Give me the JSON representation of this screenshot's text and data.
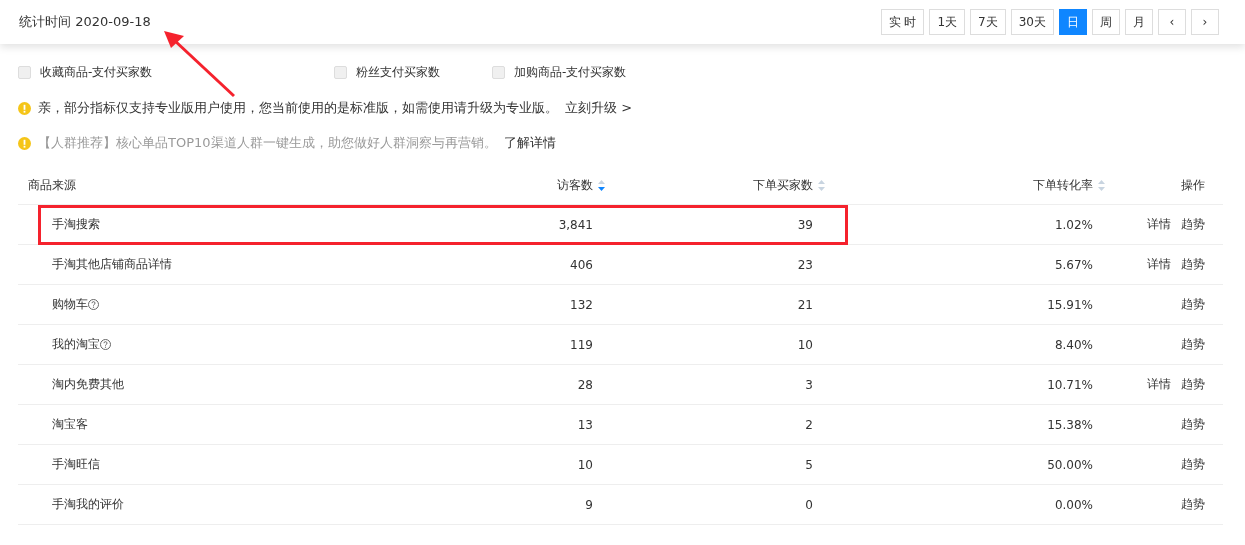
{
  "header": {
    "title": "统计时间 2020-09-18",
    "range_buttons": [
      {
        "label": "实 时",
        "selected": false
      },
      {
        "label": "1天",
        "selected": false
      },
      {
        "label": "7天",
        "selected": false
      },
      {
        "label": "30天",
        "selected": false
      },
      {
        "label": "日",
        "selected": true
      },
      {
        "label": "周",
        "selected": false
      },
      {
        "label": "月",
        "selected": false
      }
    ],
    "nav_buttons": [
      {
        "label": "‹"
      },
      {
        "label": "›"
      }
    ]
  },
  "metrics": [
    {
      "label": "收藏商品-支付买家数",
      "checked": false
    },
    {
      "label": "粉丝支付买家数",
      "checked": false
    },
    {
      "label": "加购商品-支付买家数",
      "checked": false
    }
  ],
  "notices": [
    {
      "text": "亲，部分指标仅支持专业版用户使用，您当前使用的是标准版，如需使用请升级为专业版。",
      "muted": false,
      "link": "立刻升级 >"
    },
    {
      "text": "【人群推荐】核心单品TOP10渠道人群一键生成，助您做好人群洞察与再营销。",
      "muted": true,
      "link": "了解详情"
    }
  ],
  "table": {
    "columns": [
      {
        "label": "商品来源",
        "sortable": false
      },
      {
        "label": "访客数",
        "sortable": true,
        "sorted_desc": true
      },
      {
        "label": "下单买家数",
        "sortable": true,
        "sorted_desc": false
      },
      {
        "label": "下单转化率",
        "sortable": true,
        "sorted_desc": false
      },
      {
        "label": "操作",
        "sortable": false
      }
    ],
    "rows": [
      {
        "source": "手淘搜索",
        "help": false,
        "visitors": "3,841",
        "buyers": "39",
        "rate": "1.02%",
        "actions": [
          "详情",
          "趋势"
        ],
        "boxed": true
      },
      {
        "source": "手淘其他店铺商品详情",
        "help": false,
        "visitors": "406",
        "buyers": "23",
        "rate": "5.67%",
        "actions": [
          "详情",
          "趋势"
        ],
        "boxed": false
      },
      {
        "source": "购物车",
        "help": true,
        "visitors": "132",
        "buyers": "21",
        "rate": "15.91%",
        "actions": [
          "趋势"
        ],
        "boxed": false
      },
      {
        "source": "我的淘宝",
        "help": true,
        "visitors": "119",
        "buyers": "10",
        "rate": "8.40%",
        "actions": [
          "趋势"
        ],
        "boxed": false
      },
      {
        "source": "淘内免费其他",
        "help": false,
        "visitors": "28",
        "buyers": "3",
        "rate": "10.71%",
        "actions": [
          "详情",
          "趋势"
        ],
        "boxed": false
      },
      {
        "source": "淘宝客",
        "help": false,
        "visitors": "13",
        "buyers": "2",
        "rate": "15.38%",
        "actions": [
          "趋势"
        ],
        "boxed": false
      },
      {
        "source": "手淘旺信",
        "help": false,
        "visitors": "10",
        "buyers": "5",
        "rate": "50.00%",
        "actions": [
          "趋势"
        ],
        "boxed": false
      },
      {
        "source": "手淘我的评价",
        "help": false,
        "visitors": "9",
        "buyers": "0",
        "rate": "0.00%",
        "actions": [
          "趋势"
        ],
        "boxed": false
      }
    ]
  }
}
